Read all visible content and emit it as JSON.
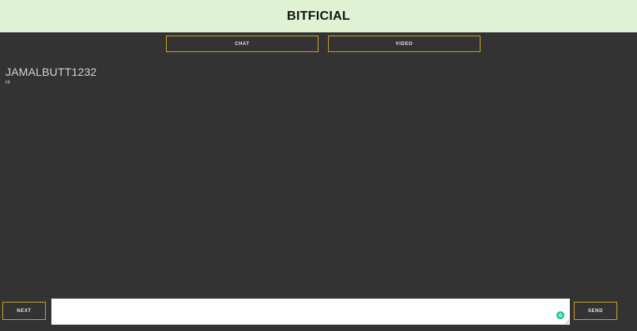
{
  "header": {
    "title": "BITFICIAL",
    "background_color": "#dff2d3"
  },
  "tabs": [
    {
      "label": "CHAT"
    },
    {
      "label": "VIDEO"
    }
  ],
  "chat": {
    "username": "JAMALBUTT1232",
    "messages": [
      {
        "text": "Hi"
      }
    ]
  },
  "footer": {
    "next_label": "NEXT",
    "send_label": "SEND",
    "input_value": "",
    "input_placeholder": ""
  },
  "icons": {
    "grammarly": "grammarly-icon",
    "resize": "resize-handle-icon"
  },
  "colors": {
    "background": "#333333",
    "button_border": "#c9a227",
    "text": "#e8e8e8",
    "grammarly": "#15c39a"
  }
}
